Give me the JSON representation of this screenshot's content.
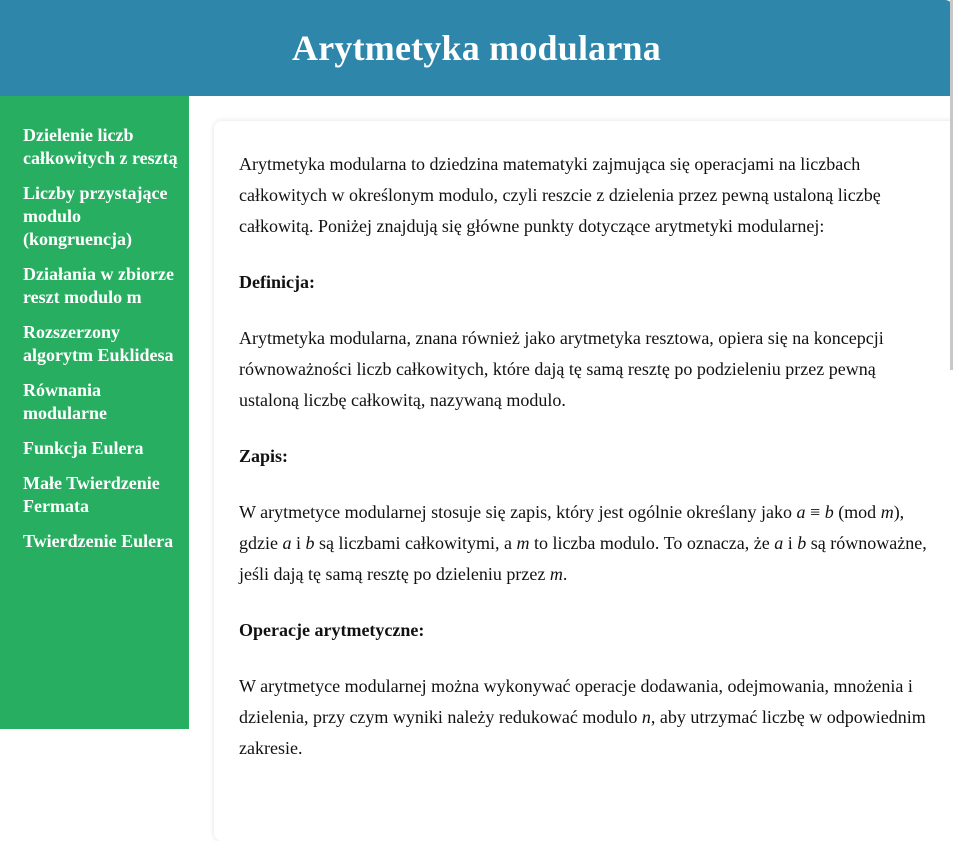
{
  "header": {
    "title": "Arytmetyka modularna"
  },
  "sidebar": {
    "items": [
      {
        "label": "Dzielenie liczb całkowitych z resztą"
      },
      {
        "label": "Liczby przystające modulo (kongruencja)"
      },
      {
        "label": "Działania w zbiorze reszt modulo m"
      },
      {
        "label": "Rozszerzony algorytm Euklidesa"
      },
      {
        "label": "Równania modularne"
      },
      {
        "label": "Funkcja Eulera"
      },
      {
        "label": "Małe Twierdzenie Fermata"
      },
      {
        "label": "Twierdzenie Eulera"
      }
    ]
  },
  "content": {
    "intro": "Arytmetyka modularna to dziedzina matematyki zajmująca się operacjami na liczbach całkowitych w określonym modulo, czyli reszcie z dzielenia przez pewną ustaloną liczbę całkowitą. Poniżej znajdują się główne punkty dotyczące arytmetyki modularnej:",
    "definition_heading": "Definicja:",
    "definition_text": "Arytmetyka modularna, znana również jako arytmetyka resztowa, opiera się na koncepcji równoważności liczb całkowitych, które dają tę samą resztę po podzieleniu przez pewną ustaloną liczbę całkowitą, nazywaną modulo.",
    "notation_heading": "Zapis:",
    "notation": {
      "t1": "W arytmetyce modularnej stosuje się zapis, który jest ogólnie określany jako ",
      "a": "a",
      "t2": " ≡ ",
      "b": "b",
      "t3": " (mod ",
      "m": "m",
      "t4": "), gdzie ",
      "a2": "a",
      "t5": " i ",
      "b2": "b",
      "t6": " są liczbami całkowitymi, a ",
      "m2": "m",
      "t7": " to liczba modulo. To oznacza, że ",
      "a3": "a",
      "t8": " i ",
      "b3": "b",
      "t9": " są równoważne, jeśli dają tę samą resztę po dzieleniu przez ",
      "m3": "m",
      "t10": "."
    },
    "operations_heading": "Operacje arytmetyczne:",
    "operations": {
      "t1": "W arytmetyce modularnej można wykonywać operacje dodawania, odejmowania, mnożenia i dzielenia, przy czym wyniki należy redukować modulo ",
      "n": "n",
      "t2": ", aby utrzymać liczbę w odpowiednim zakresie."
    }
  },
  "colors": {
    "header": "#2e86ab",
    "sidebar": "#27ae60"
  }
}
